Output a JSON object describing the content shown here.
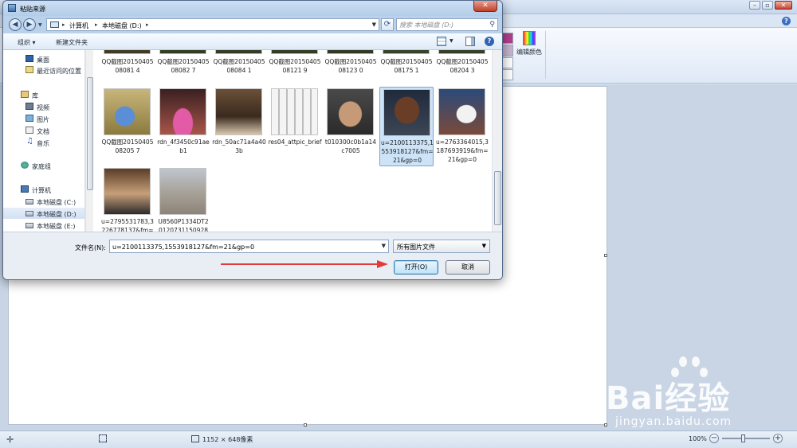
{
  "dialog": {
    "title": "粘贴来源",
    "address": [
      "计算机",
      "本地磁盘 (D:)"
    ],
    "search_placeholder": "搜索 本地磁盘 (D:)",
    "toolbar": {
      "organize": "组织",
      "new_folder": "新建文件夹"
    },
    "nav": [
      {
        "label": "桌面",
        "icon": "desktop-icon"
      },
      {
        "label": "最近访问的位置",
        "icon": "recent-places-icon"
      },
      {
        "label": "库",
        "icon": "library-icon"
      },
      {
        "label": "视频",
        "icon": "video-icon"
      },
      {
        "label": "图片",
        "icon": "pictures-icon"
      },
      {
        "label": "文档",
        "icon": "documents-icon"
      },
      {
        "label": "音乐",
        "icon": "music-icon"
      },
      {
        "label": "家庭组",
        "icon": "homegroup-icon"
      },
      {
        "label": "计算机",
        "icon": "computer-icon"
      },
      {
        "label": "本地磁盘 (C:)",
        "icon": "drive-icon"
      },
      {
        "label": "本地磁盘 (D:)",
        "icon": "drive-icon"
      },
      {
        "label": "本地磁盘 (E:)",
        "icon": "drive-icon"
      }
    ],
    "files_row1": [
      "QQ截图2015040508081 4",
      "QQ截图2015040508082 7",
      "QQ截图2015040508084 1",
      "QQ截图2015040508121 9",
      "QQ截图2015040508123 0",
      "QQ截图2015040508175 1",
      "QQ截图2015040508204 3"
    ],
    "files_row2": [
      "QQ截图2015040508205 7",
      "rdn_4f3450c91aeb1",
      "rdn_50ac71a4a403b",
      "res04_attpic_brief",
      "t010300c0b1a14c7005",
      "u=2100113375,1553918127&fm=21&gp=0",
      "u=2763364015,3187693919&fm=21&gp=0"
    ],
    "files_row3": [
      "u=2795531783,3226778137&fm=21&gp=0",
      "U8560P1334DT20120731150928"
    ],
    "filename_label": "文件名(N):",
    "filename_value": "u=2100113375,1553918127&fm=21&gp=0",
    "filter": "所有图片文件",
    "open_button": "打开(O)",
    "cancel_button": "取消"
  },
  "paint": {
    "edit_colors": "编辑颜色",
    "image_size": "1152 × 648像素",
    "zoom": "100%"
  },
  "watermark": {
    "brand": "Bai经验",
    "url": "jingyan.baidu.com"
  }
}
